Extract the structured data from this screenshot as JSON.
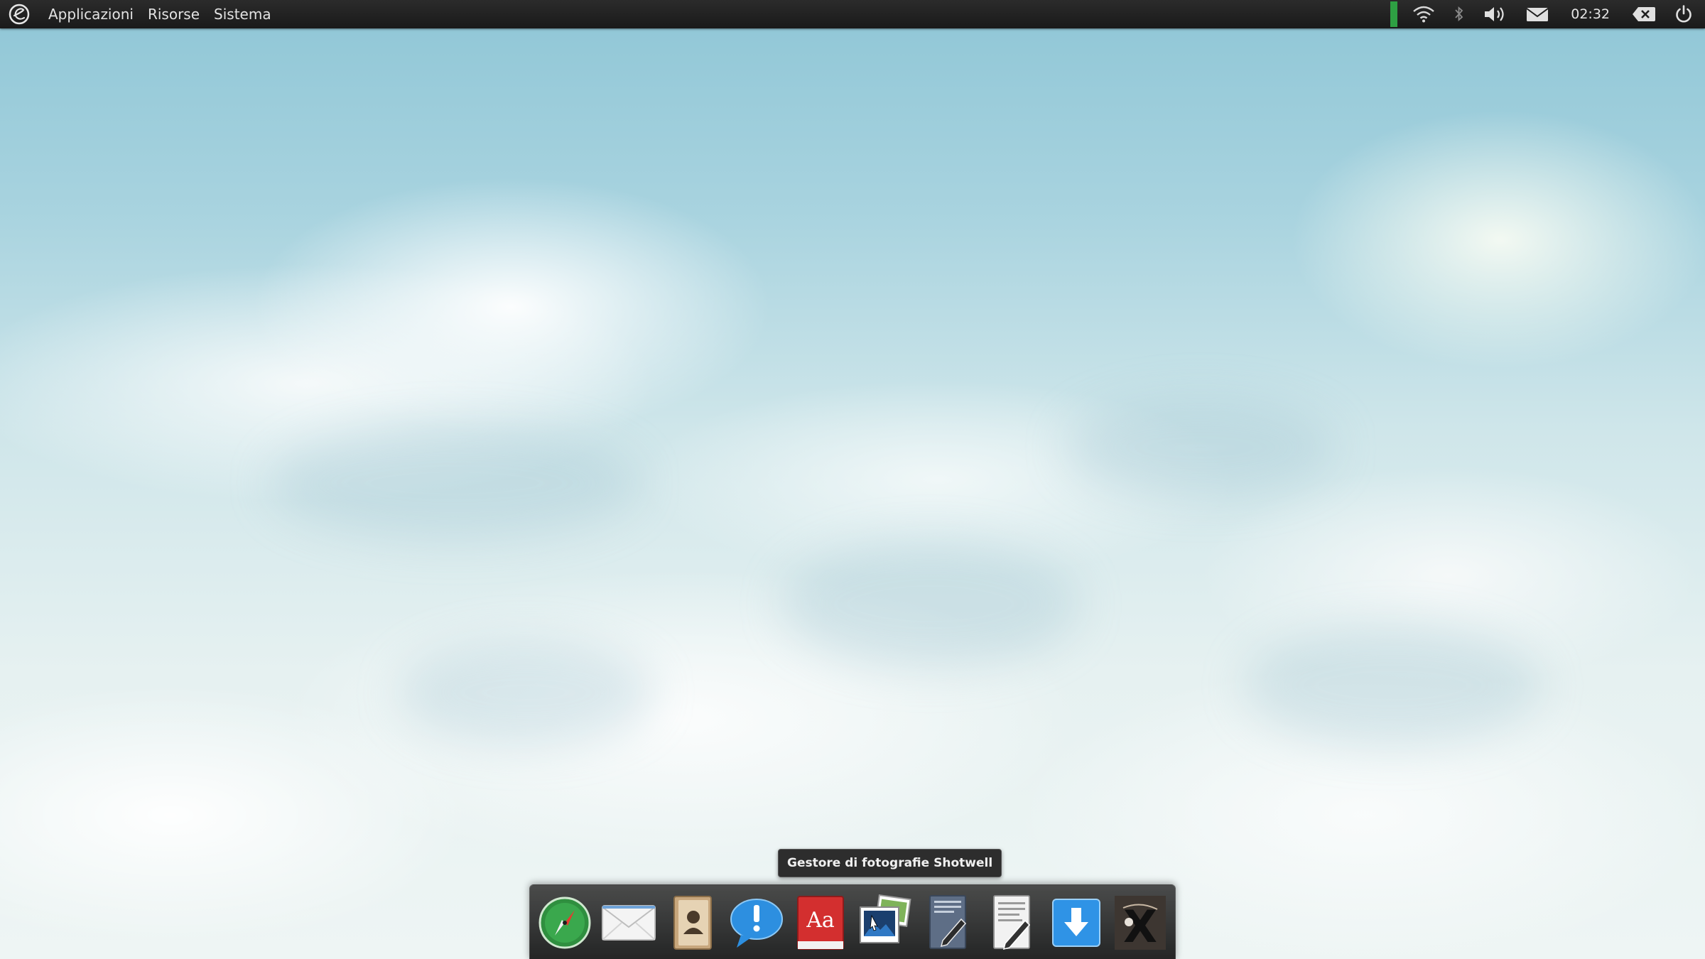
{
  "panel": {
    "logo_glyph": "e",
    "menu": [
      "Applicazioni",
      "Risorse",
      "Sistema"
    ],
    "clock": "02:32"
  },
  "tooltip": {
    "text": "Gestore di fotografie Shotwell"
  },
  "dock": {
    "items": [
      {
        "icon": "browser-compass-icon"
      },
      {
        "icon": "mail-envelope-icon"
      },
      {
        "icon": "contacts-book-icon"
      },
      {
        "icon": "chat-bubble-icon"
      },
      {
        "icon": "dictionary-icon",
        "glyph": "Aa"
      },
      {
        "icon": "shotwell-photos-icon"
      },
      {
        "icon": "text-editor-icon"
      },
      {
        "icon": "document-editor-icon"
      },
      {
        "icon": "download-icon"
      },
      {
        "icon": "x-app-icon",
        "glyph": "X"
      }
    ]
  },
  "colors": {
    "panel_bg": "#1f1f1f",
    "network_active": "#2ea043"
  }
}
